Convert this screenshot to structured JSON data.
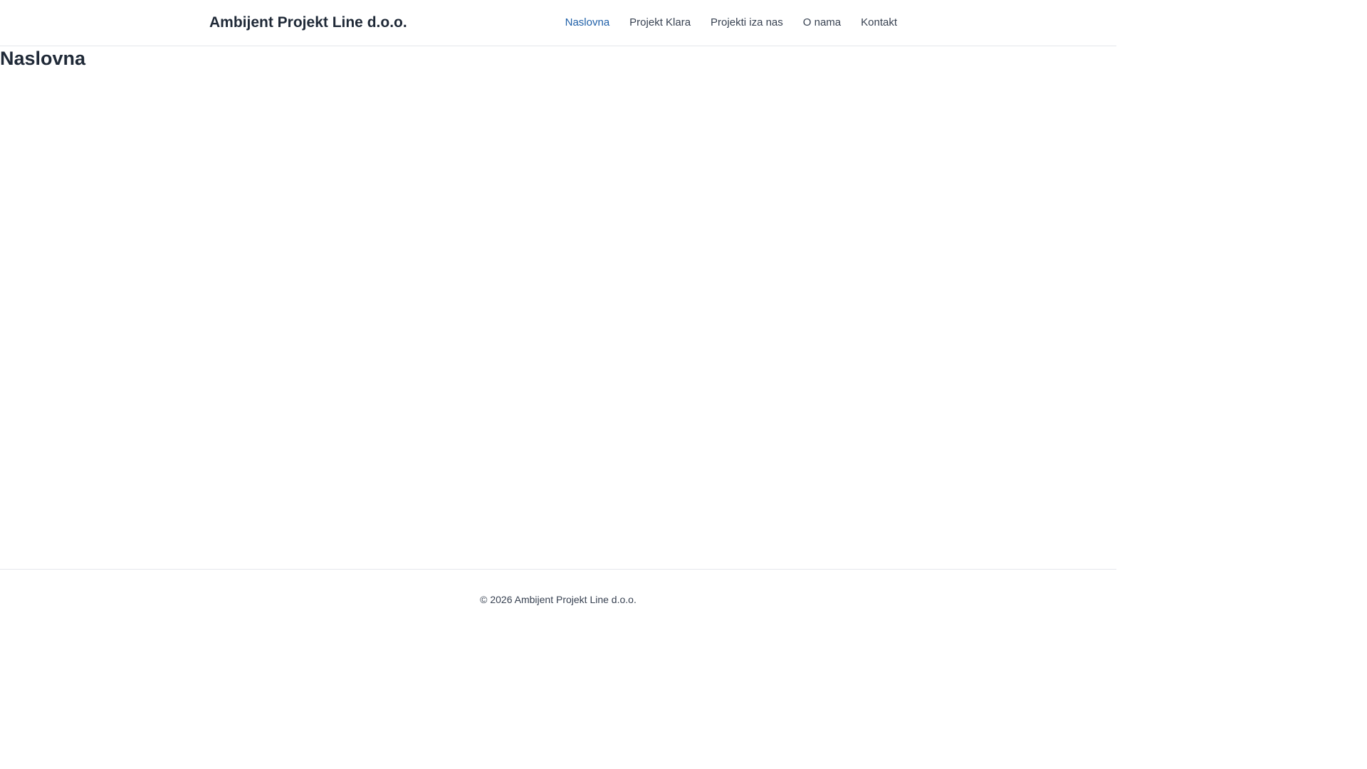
{
  "header": {
    "brand": "Ambijent Projekt Line d.o.o.",
    "nav": [
      {
        "label": "Naslovna",
        "active": true
      },
      {
        "label": "Projekt Klara",
        "active": false
      },
      {
        "label": "Projekti iza nas",
        "active": false
      },
      {
        "label": "O nama",
        "active": false
      },
      {
        "label": "Kontakt",
        "active": false
      }
    ]
  },
  "main": {
    "title": "Naslovna"
  },
  "footer": {
    "copyright": "© 2026 Ambijent Projekt Line d.o.o."
  },
  "colors": {
    "active_link": "#1e5fa8",
    "text": "#1f2937",
    "border": "#e5e7eb"
  }
}
